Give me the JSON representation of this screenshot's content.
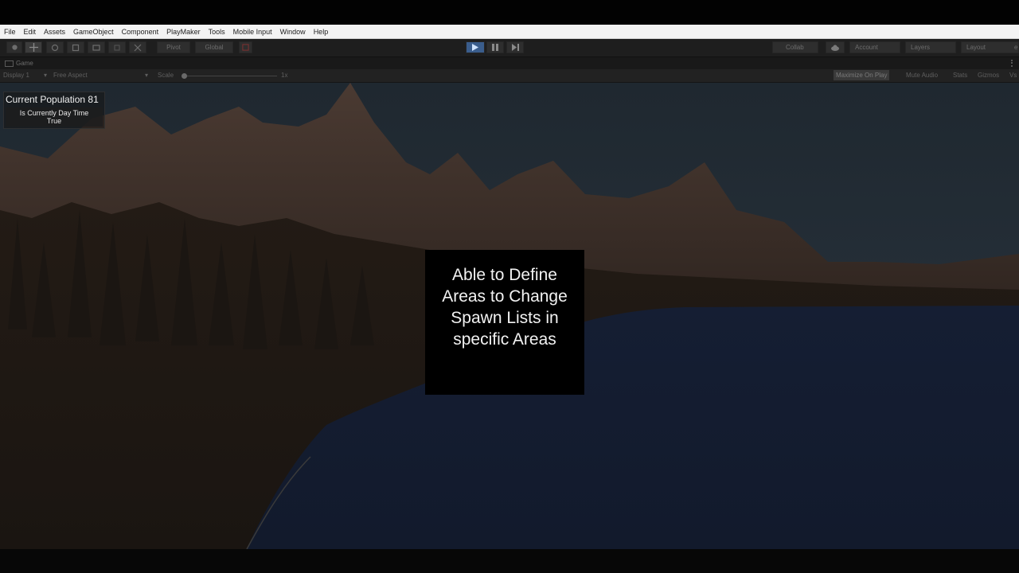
{
  "menu": {
    "items": [
      "File",
      "Edit",
      "Assets",
      "GameObject",
      "Component",
      "PlayMaker",
      "Tools",
      "Mobile Input",
      "Window",
      "Help"
    ]
  },
  "toolbar": {
    "pivot_label": "Pivot",
    "global_label": "Global",
    "collab_label": "Collab",
    "account_label": "Account",
    "layers_label": "Layers",
    "layout_label": "Layout",
    "layout_suffix": "e"
  },
  "game_view": {
    "tab_label": "Game",
    "display_label": "Display 1",
    "aspect_label": "Free Aspect",
    "scale_label": "Scale",
    "scale_value": "1x",
    "maximize_label": "Maximize On Play",
    "mute_label": "Mute Audio",
    "stats_label": "Stats",
    "gizmos_label": "Gizmos",
    "vsync_label": "Vs"
  },
  "hud": {
    "population_label": "Current Population 81",
    "daytime_label": "Is Currently Day Time",
    "daytime_value": "True"
  },
  "callout": {
    "lines": [
      "Able to Define",
      "Areas to Change",
      "Spawn Lists in",
      "specific Areas"
    ]
  },
  "colors": {
    "accent_play": "#3a5d8c",
    "sky": "#232c35",
    "water": "#141d33"
  }
}
